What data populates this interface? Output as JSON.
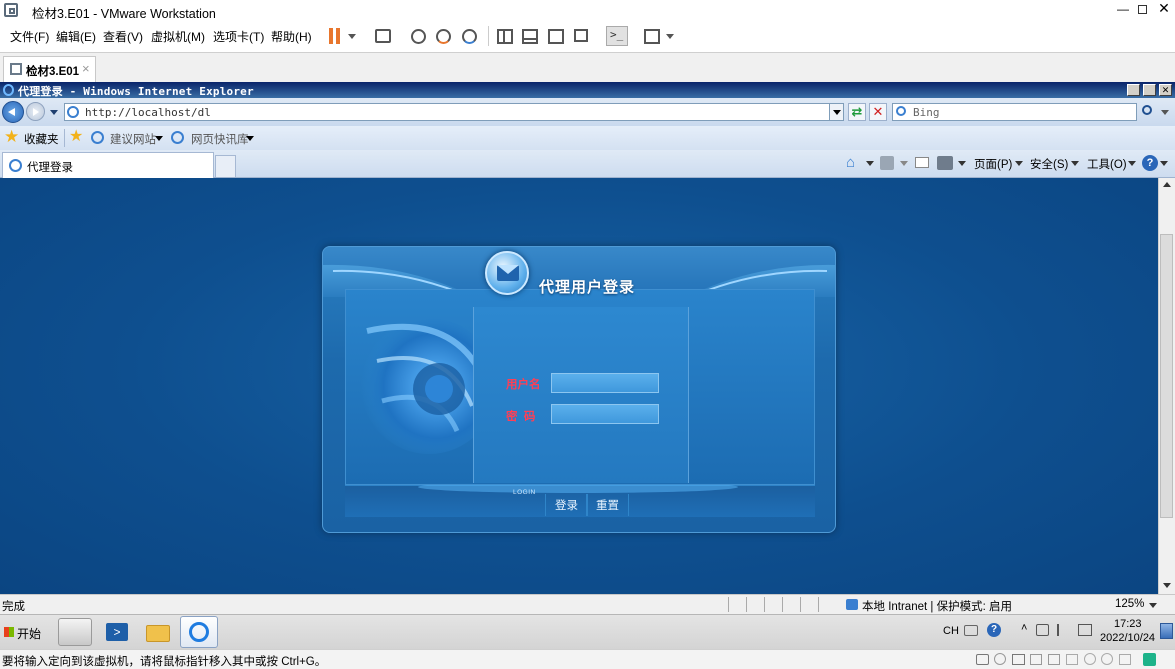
{
  "vm": {
    "title": "检材3.E01 - VMware Workstation",
    "menu": [
      "文件(F)",
      "编辑(E)",
      "查看(V)",
      "虚拟机(M)",
      "选项卡(T)",
      "帮助(H)"
    ],
    "tab_label": "检材3.E01",
    "tab_close": "×",
    "hint": "要将输入定向到该虚拟机，请将鼠标指针移入其中或按 Ctrl+G。"
  },
  "ie": {
    "title": "代理登录 - Windows Internet Explorer",
    "address": "http://localhost/dl",
    "search_placeholder": "Bing",
    "favorites_label": "收藏夹",
    "suggested_sites": "建议网站",
    "web_slice": "网页快讯库",
    "tab_title": "代理登录",
    "cmd": {
      "page": "页面(P)",
      "safety": "安全(S)",
      "tools": "工具(O)"
    },
    "status": {
      "done": "完成",
      "zone": "本地 Intranet | 保护模式: 启用",
      "zoom": "125%"
    }
  },
  "login": {
    "title": "代理用户登录",
    "username_label": "用户名",
    "password_label": "密  码",
    "login_caption": "LOGIN",
    "login_button": "登录",
    "reset_button": "重置"
  },
  "taskbar": {
    "start_label": "开始",
    "lang": "CH",
    "time": "17:23",
    "date": "2022/10/24"
  },
  "colors": {
    "page_bg": "#0f5193",
    "label_red": "#ff3f55",
    "ie_title": "#0a246a"
  }
}
